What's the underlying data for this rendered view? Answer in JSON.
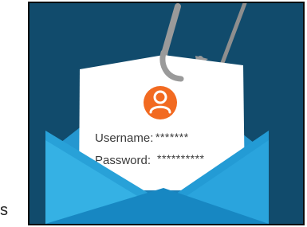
{
  "credentials": {
    "username_label": "Username:",
    "username_value": "*******",
    "password_label": "Password:",
    "password_value": "**********"
  },
  "stray_text": "s",
  "icons": {
    "hook": "fishing-hook-icon",
    "user": "user-avatar-icon",
    "envelope": "open-envelope-icon"
  },
  "colors": {
    "background": "#114b6c",
    "envelope_light": "#35b1e4",
    "envelope_mid": "#1f96d0",
    "envelope_dark": "#1787c2",
    "card": "#ffffff",
    "avatar": "#f26a21",
    "hook": "#9a9a9a"
  }
}
